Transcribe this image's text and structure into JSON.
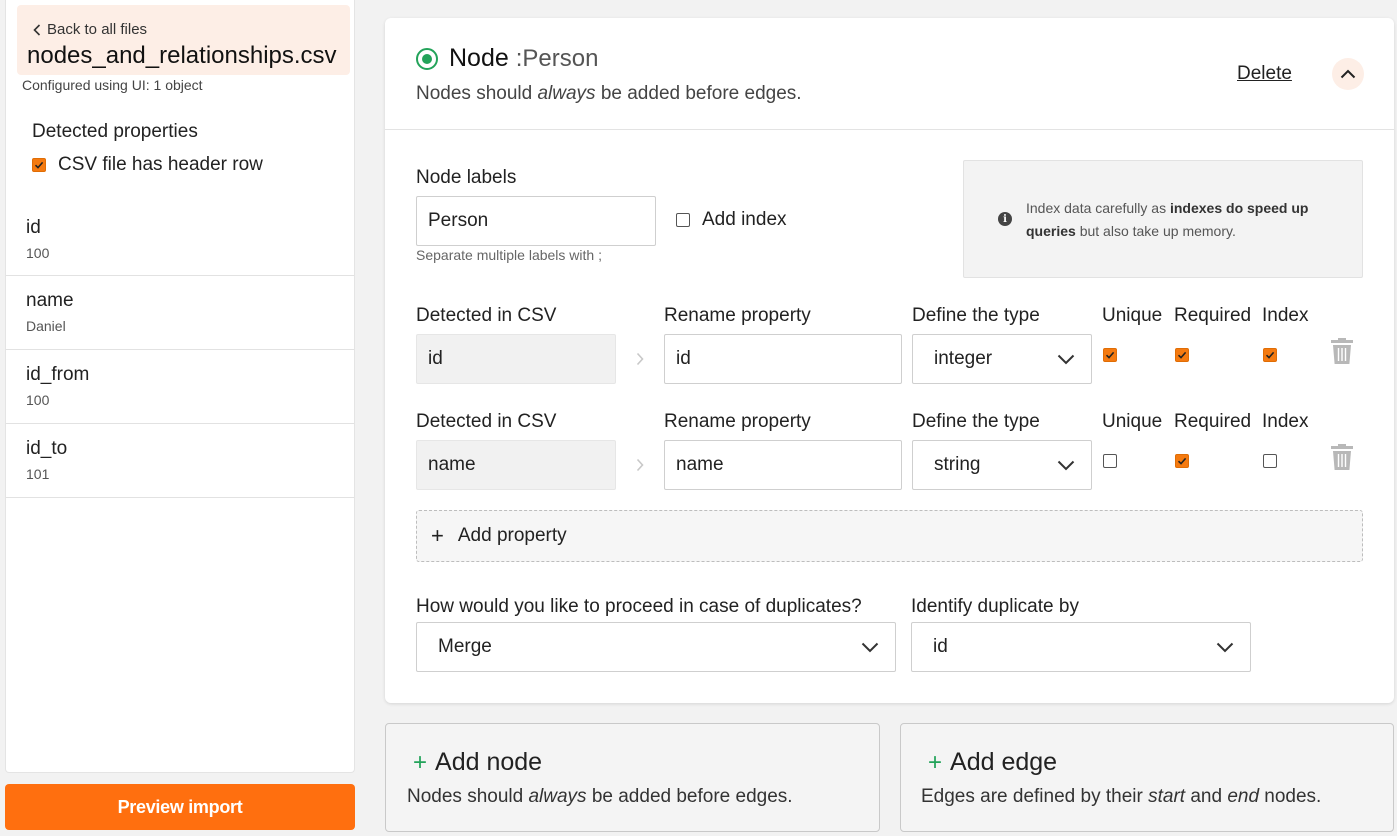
{
  "sidebar": {
    "back_label": "Back to all files",
    "file_name": "nodes_and_relationships.csv",
    "configured": "Configured using UI: 1 object",
    "detected_title": "Detected properties",
    "header_row_label": "CSV file has header row",
    "header_row_checked": true,
    "properties": [
      {
        "name": "id",
        "value": "100"
      },
      {
        "name": "name",
        "value": "Daniel"
      },
      {
        "name": "id_from",
        "value": "100"
      },
      {
        "name": "id_to",
        "value": "101"
      }
    ],
    "preview_button": "Preview import"
  },
  "node": {
    "title": "Node",
    "label_suffix": ":Person",
    "subtitle_pre": "Nodes should ",
    "subtitle_em": "always",
    "subtitle_post": " be added before edges.",
    "delete_label": "Delete",
    "labels_field_label": "Node labels",
    "labels_value": "Person",
    "labels_hint": "Separate multiple labels with ;",
    "add_index_label": "Add index",
    "add_index_checked": false,
    "info_pre": "Index data carefully as ",
    "info_bold": "indexes do speed up queries",
    "info_post": " but also take up memory.",
    "columns": {
      "detected": "Detected in CSV",
      "rename": "Rename property",
      "type": "Define the type",
      "unique": "Unique",
      "required": "Required",
      "index": "Index"
    },
    "properties": [
      {
        "detected": "id",
        "rename": "id",
        "type": "integer",
        "unique": true,
        "required": true,
        "index": true
      },
      {
        "detected": "name",
        "rename": "name",
        "type": "string",
        "unique": false,
        "required": true,
        "index": false
      }
    ],
    "add_property_label": "Add property",
    "duplicates_label": "How would you like to proceed in case of duplicates?",
    "duplicates_value": "Merge",
    "identify_label": "Identify duplicate by",
    "identify_value": "id"
  },
  "add_node": {
    "title": "Add node",
    "sub_pre": "Nodes should ",
    "sub_em": "always",
    "sub_post": " be added before edges."
  },
  "add_edge": {
    "title": "Add edge",
    "sub_pre": "Edges are defined by their ",
    "sub_em1": "start",
    "sub_mid": " and ",
    "sub_em2": "end",
    "sub_post": " nodes."
  },
  "colors": {
    "accent": "#ff6f0f",
    "checkbox": "#f47a10",
    "success": "#23a35a",
    "highlight_bg": "#fdeee6"
  }
}
